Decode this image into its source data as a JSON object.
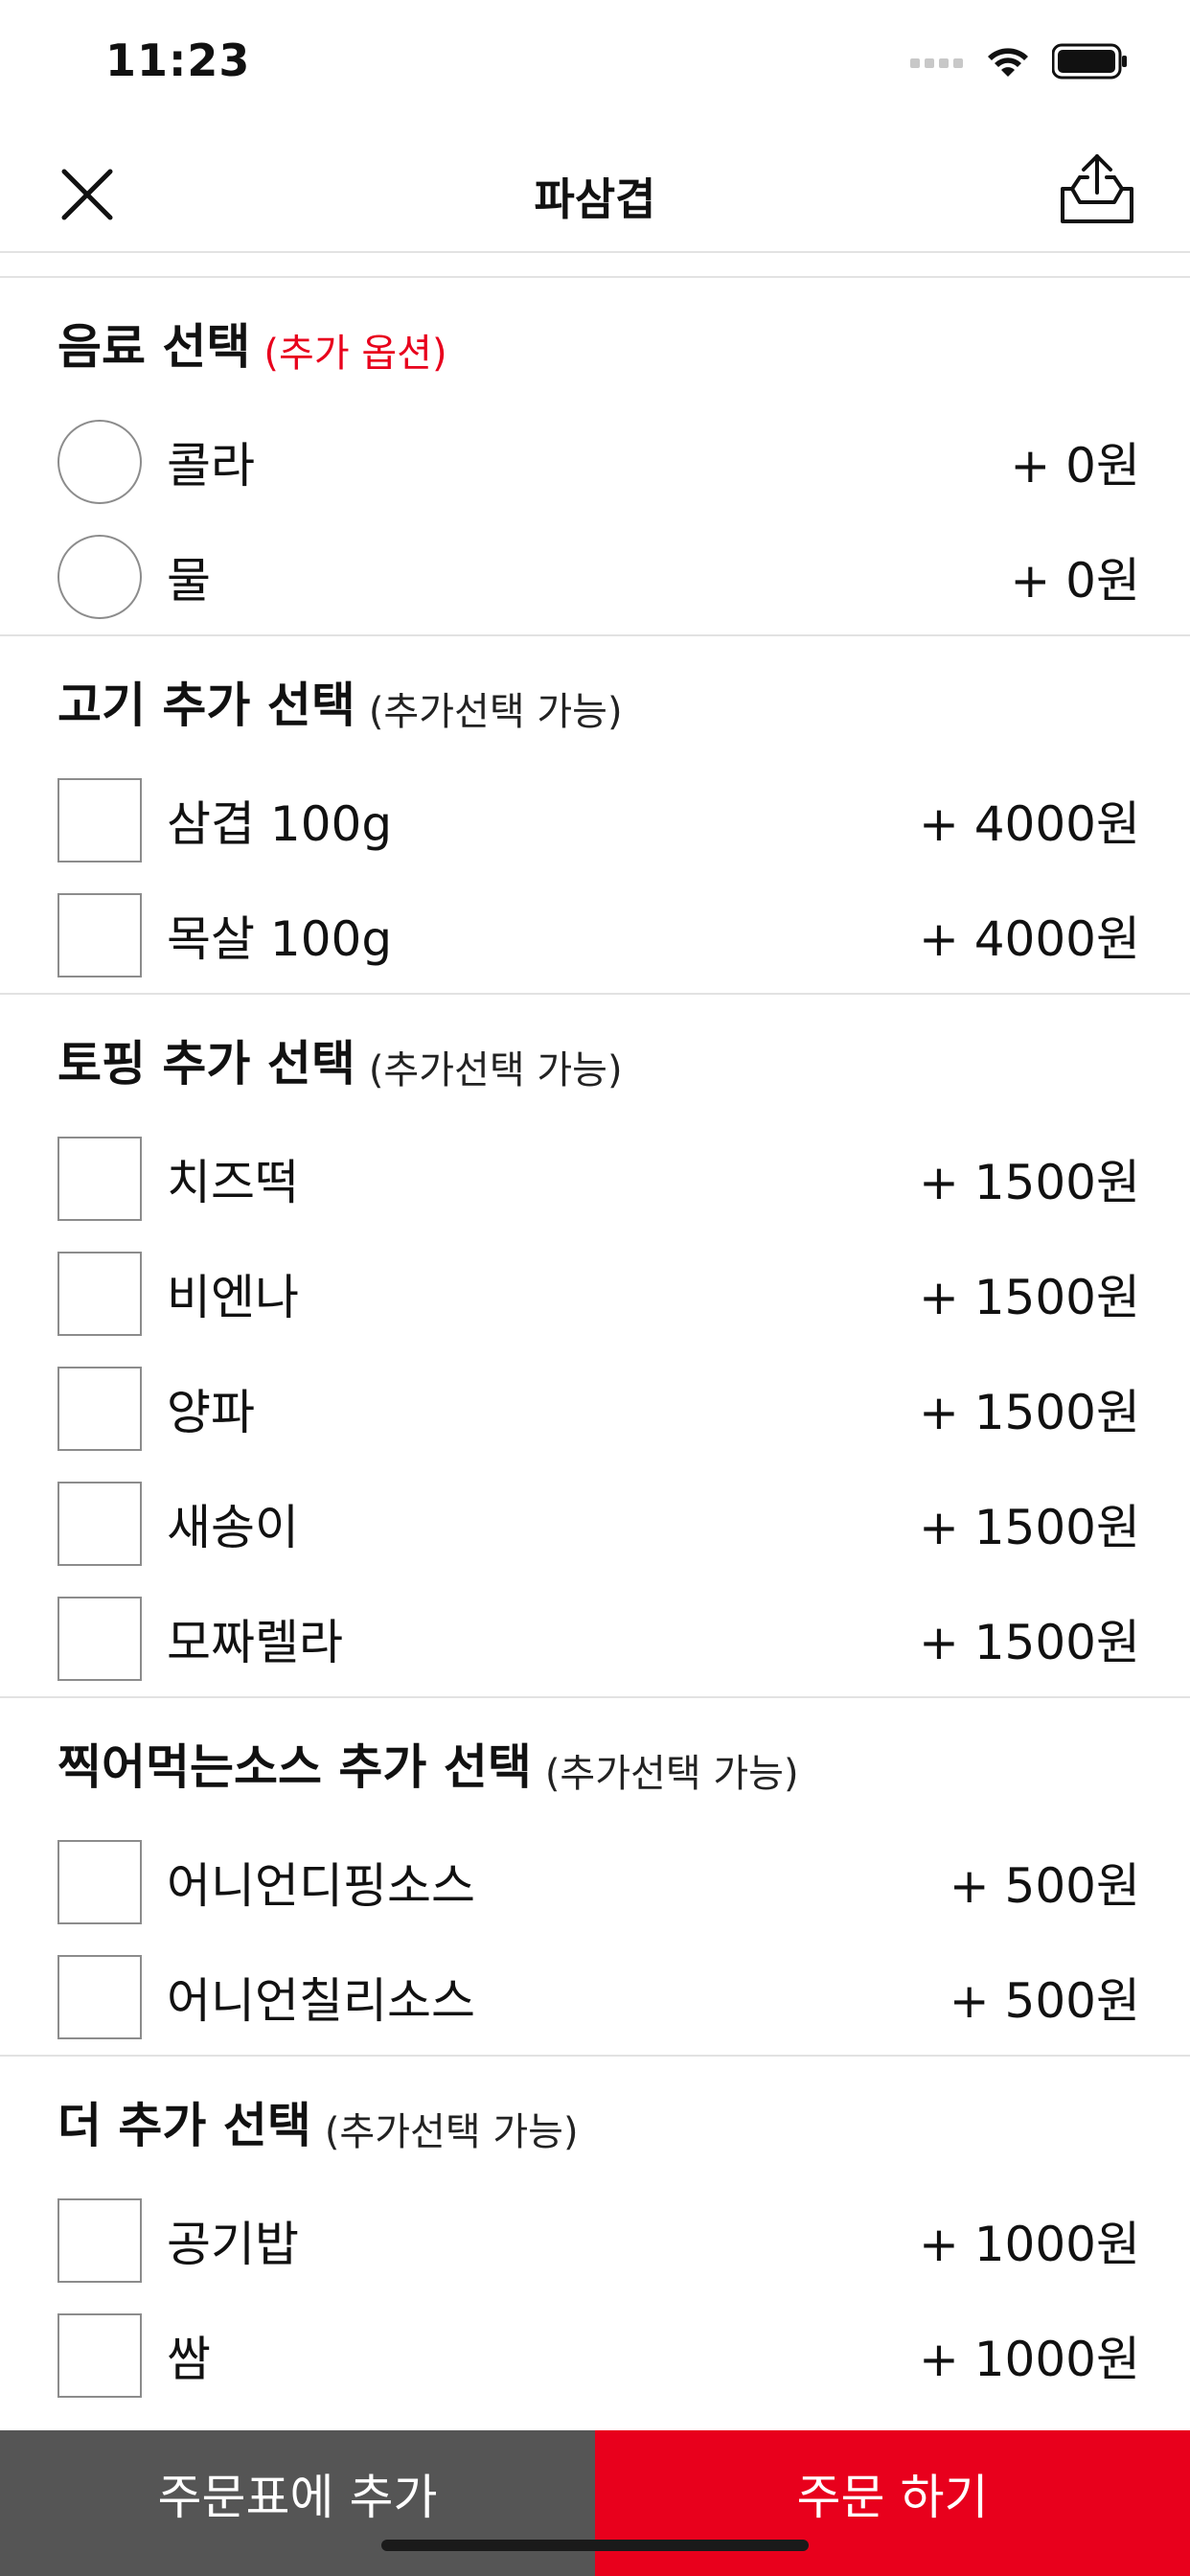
{
  "status_bar": {
    "time": "11:23",
    "icons": [
      "signal-icon",
      "wifi-icon",
      "battery-icon"
    ]
  },
  "nav": {
    "title": "파삼겹",
    "close_icon": "close-icon",
    "share_icon": "share-icon"
  },
  "sections": [
    {
      "title": "음료 선택",
      "hint": "(추가 옵션)",
      "hint_color": "#e8001c",
      "control": "radio",
      "options": [
        {
          "label": "콜라",
          "price": "+ 0원"
        },
        {
          "label": "물",
          "price": "+ 0원"
        }
      ]
    },
    {
      "title": "고기 추가 선택",
      "hint": "(추가선택 가능)",
      "control": "checkbox",
      "options": [
        {
          "label": "삼겹 100g",
          "price": "+ 4000원"
        },
        {
          "label": "목살 100g",
          "price": "+ 4000원"
        }
      ]
    },
    {
      "title": "토핑 추가 선택",
      "hint": "(추가선택 가능)",
      "control": "checkbox",
      "options": [
        {
          "label": "치즈떡",
          "price": "+ 1500원"
        },
        {
          "label": "비엔나",
          "price": "+ 1500원"
        },
        {
          "label": "양파",
          "price": "+ 1500원"
        },
        {
          "label": "새송이",
          "price": "+ 1500원"
        },
        {
          "label": "모짜렐라",
          "price": "+ 1500원"
        }
      ]
    },
    {
      "title": "찍어먹는소스 추가 선택",
      "hint": "(추가선택 가능)",
      "control": "checkbox",
      "options": [
        {
          "label": "어니언디핑소스",
          "price": "+ 500원"
        },
        {
          "label": "어니언칠리소스",
          "price": "+ 500원"
        }
      ]
    },
    {
      "title": "더 추가 선택",
      "hint": "(추가선택 가능)",
      "control": "checkbox",
      "options": [
        {
          "label": "공기밥",
          "price": "+ 1000원"
        },
        {
          "label": "쌈",
          "price": "+ 1000원"
        }
      ]
    }
  ],
  "bottom_bar": {
    "add_to_cart": "주문표에 추가",
    "order_now": "주문 하기",
    "cart_color": "#555555",
    "order_color": "#e8001c"
  }
}
